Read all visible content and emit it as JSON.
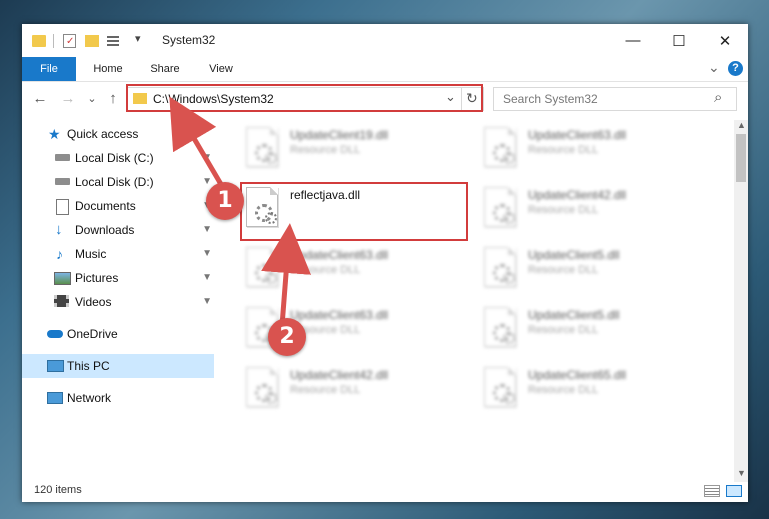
{
  "window": {
    "title": "System32",
    "minimize_glyph": "—",
    "maximize_glyph": "☐",
    "close_glyph": "✕"
  },
  "ribbon": {
    "tabs": [
      "File",
      "Home",
      "Share",
      "View"
    ],
    "expand_glyph": "⌄",
    "help_glyph": "?"
  },
  "nav": {
    "back_glyph": "←",
    "forward_glyph": "→",
    "recent_glyph": "⌄",
    "up_glyph": "↑",
    "address": "C:\\Windows\\System32",
    "address_dropdown_glyph": "⌄",
    "refresh_glyph": "↻",
    "search_placeholder": "Search System32",
    "search_glyph": "⌕"
  },
  "sidebar": {
    "quick_access": "Quick access",
    "items": [
      {
        "label": "Local Disk (C:)",
        "icon": "drive-icon",
        "pinned": true
      },
      {
        "label": "Local Disk (D:)",
        "icon": "drive-icon",
        "pinned": true
      },
      {
        "label": "Documents",
        "icon": "documents-icon",
        "pinned": true
      },
      {
        "label": "Downloads",
        "icon": "downloads-icon",
        "pinned": true
      },
      {
        "label": "Music",
        "icon": "music-icon",
        "pinned": true
      },
      {
        "label": "Pictures",
        "icon": "pictures-icon",
        "pinned": true
      },
      {
        "label": "Videos",
        "icon": "videos-icon",
        "pinned": true
      }
    ],
    "onedrive": "OneDrive",
    "this_pc": "This PC",
    "network": "Network",
    "pin_glyph": "📌"
  },
  "files": {
    "left": [
      {
        "name": "UpdateClient19.dll",
        "type": "Resource DLL",
        "blurred": true
      },
      {
        "name": "reflectjava.dll",
        "type": "",
        "blurred": false
      },
      {
        "name": "UpdateClient63.dll",
        "type": "Resource DLL",
        "blurred": true
      },
      {
        "name": "UpdateClient63.dll",
        "type": "Resource DLL",
        "blurred": true
      },
      {
        "name": "UpdateClient42.dll",
        "type": "Resource DLL",
        "blurred": true
      }
    ],
    "right": [
      {
        "name": "UpdateClient63.dll",
        "type": "Resource DLL",
        "blurred": true
      },
      {
        "name": "UpdateClient42.dll",
        "type": "Resource DLL",
        "blurred": true
      },
      {
        "name": "UpdateClient5.dll",
        "type": "Resource DLL",
        "blurred": true
      },
      {
        "name": "UpdateClient5.dll",
        "type": "Resource DLL",
        "blurred": true
      },
      {
        "name": "UpdateClient65.dll",
        "type": "Resource DLL",
        "blurred": true
      }
    ]
  },
  "status": {
    "item_count": "120 items"
  },
  "annotations": {
    "step1": "1",
    "step2": "2",
    "highlight_color": "#d23c3c"
  },
  "colors": {
    "accent": "#1979ca",
    "folder": "#f2c94c",
    "selected_nav": "#cce8ff"
  }
}
